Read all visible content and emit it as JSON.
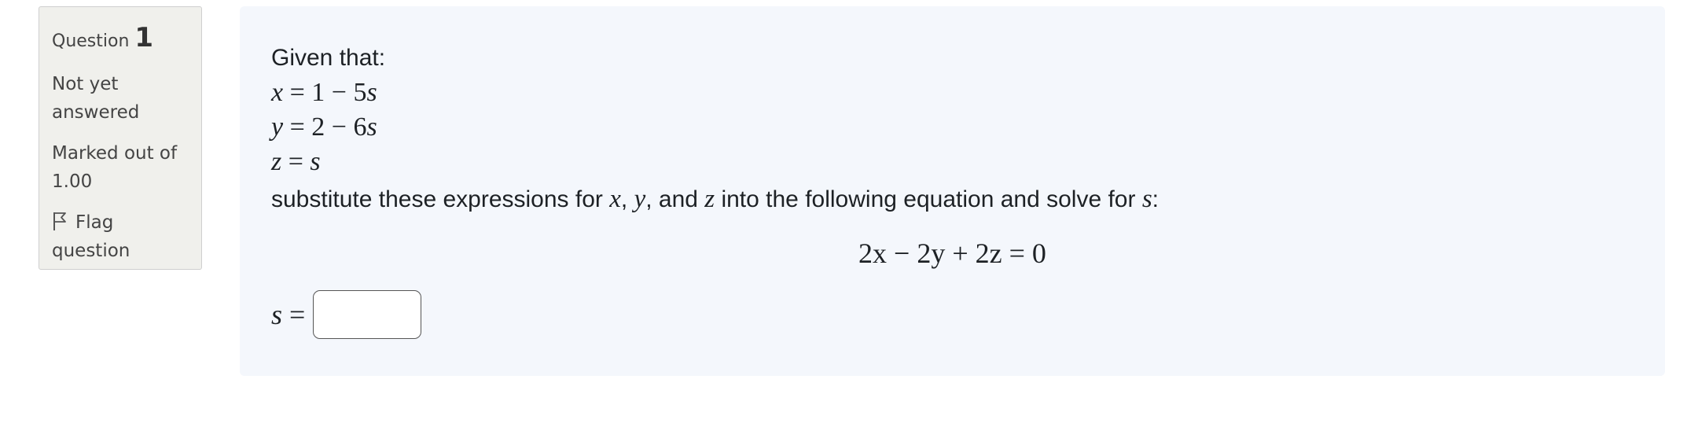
{
  "question_info": {
    "question_label": "Question",
    "question_number": "1",
    "state_line1": "Not yet",
    "state_line2": "answered",
    "grade_line1": "Marked out of",
    "grade_line2": "1.00",
    "flag_line1": "Flag",
    "flag_line2": "question",
    "flag_icon": "flag-outline-icon"
  },
  "question": {
    "intro": "Given that:",
    "equations": [
      {
        "var": "x",
        "eq": " = 1 − 5",
        "svar": "s"
      },
      {
        "var": "y",
        "eq": " = 2 − 6",
        "svar": "s"
      },
      {
        "var": "z",
        "eq": " = ",
        "svar": "s"
      }
    ],
    "sub_part1": "substitute these expressions for ",
    "sub_x": "x",
    "sub_comma1": ", ",
    "sub_y": "y",
    "sub_and": ", and ",
    "sub_z": "z",
    "sub_part2": " into the following equation and solve for ",
    "sub_s": "s",
    "sub_end": ":",
    "display_equation": "2x − 2y + 2z = 0"
  },
  "answer": {
    "label_var": "s",
    "label_eq": " =",
    "value": "",
    "placeholder": ""
  }
}
